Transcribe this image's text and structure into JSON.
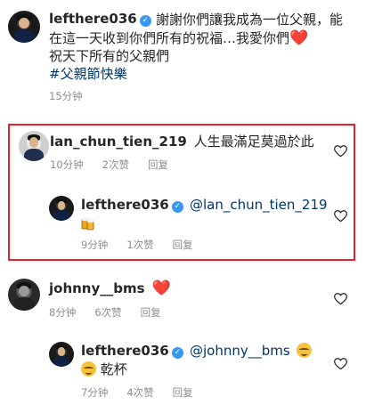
{
  "post": {
    "username": "lefthere036",
    "caption_line1": "謝謝你們讓我成為一位父親，能",
    "caption_line2": "在這一天收到你們所有的祝福…我愛你們",
    "caption_line3": "祝天下所有的父親們",
    "hashtag": "#父親節快樂",
    "time": "15分钟",
    "heart_emoji": "❤️"
  },
  "comments": [
    {
      "username": "lan_chun_tien_219",
      "text": "人生最滿足莫過於此",
      "time": "10分钟",
      "likes": "2次赞",
      "reply_label": "回复",
      "reply": {
        "username": "lefthere036",
        "mention": "@lan_chun_tien_219",
        "emoji": "🍻",
        "time": "9分钟",
        "likes": "1次赞",
        "reply_label": "回复"
      }
    },
    {
      "username": "johnny__bms",
      "text": "❤️",
      "time": "8分钟",
      "likes": "6次赞",
      "reply_label": "回复",
      "reply": {
        "username": "lefthere036",
        "mention": "@johnny__bms",
        "emoji": "😌",
        "text": "乾杯",
        "time": "7分钟",
        "likes": "4次赞",
        "reply_label": "回复"
      }
    }
  ],
  "icons": {
    "verified": "verified-badge-icon",
    "like": "heart-outline-icon"
  },
  "colors": {
    "highlight_border": "#e5242b",
    "verified": "#3897f0",
    "link": "#003569",
    "meta": "#8e8e8e"
  }
}
